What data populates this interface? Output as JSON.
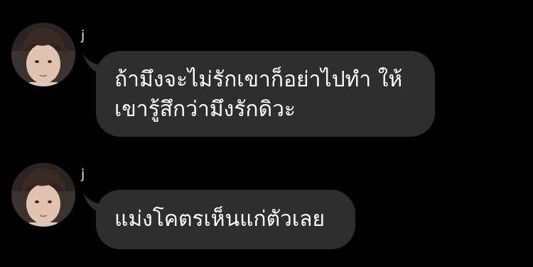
{
  "colors": {
    "background": "#000000",
    "bubble": "#2e2e2e",
    "text": "#ffffff",
    "sender": "#e6e6e6"
  },
  "messages": [
    {
      "sender": "j",
      "avatar_icon": "profile-photo",
      "text": "ถ้ามึงจะไม่รักเขาก็อย่าไปทำ ให้\nเขารู้สึกว่ามึงรักดิวะ"
    },
    {
      "sender": "j",
      "avatar_icon": "profile-photo",
      "text": "แม่งโคตรเห็นแก่ตัวเลย"
    }
  ]
}
